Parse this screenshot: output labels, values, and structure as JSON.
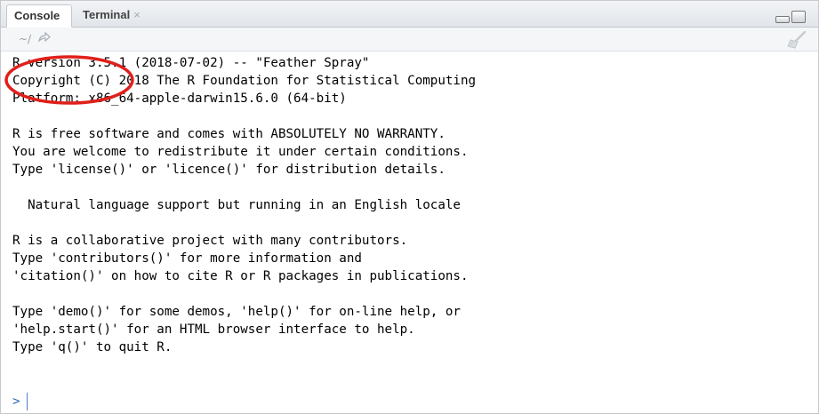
{
  "tabs": [
    {
      "label": "Console",
      "active": true
    },
    {
      "label": "Terminal",
      "active": false,
      "close": "×"
    }
  ],
  "toolbar": {
    "working_dir": "~/",
    "goto_icon": "forward-arrow-icon",
    "clear_icon": "broom-icon"
  },
  "console": {
    "lines": [
      "R version 3.5.1 (2018-07-02) -- \"Feather Spray\"",
      "Copyright (C) 2018 The R Foundation for Statistical Computing",
      "Platform: x86_64-apple-darwin15.6.0 (64-bit)",
      "",
      "R is free software and comes with ABSOLUTELY NO WARRANTY.",
      "You are welcome to redistribute it under certain conditions.",
      "Type 'license()' or 'licence()' for distribution details.",
      "",
      "  Natural language support but running in an English locale",
      "",
      "R is a collaborative project with many contributors.",
      "Type 'contributors()' for more information and",
      "'citation()' on how to cite R or R packages in publications.",
      "",
      "Type 'demo()' for some demos, 'help()' for on-line help, or",
      "'help.start()' for an HTML browser interface to help.",
      "Type 'q()' to quit R."
    ],
    "prompt": ">"
  },
  "colors": {
    "annotation": "#e0201b",
    "prompt": "#2c65b5"
  }
}
